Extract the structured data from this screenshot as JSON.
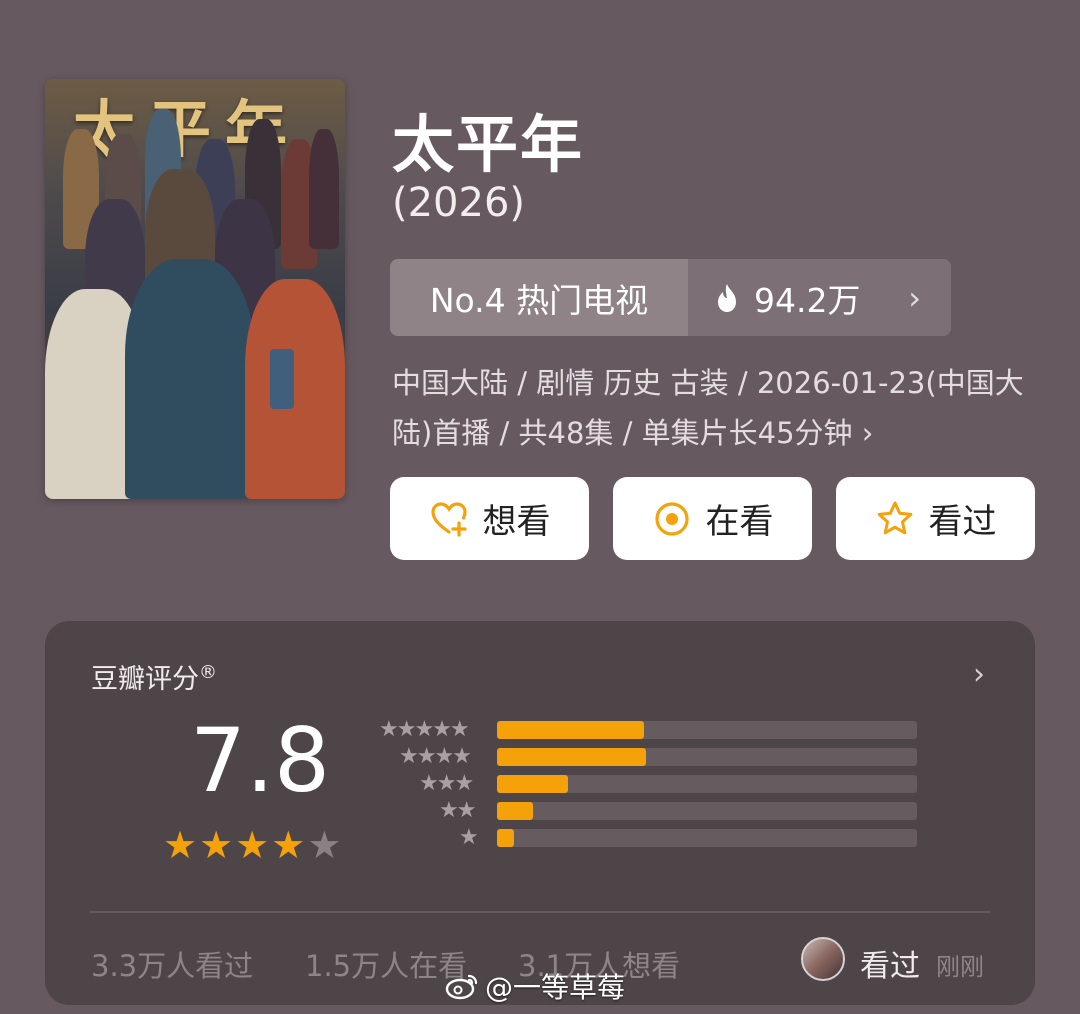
{
  "poster": {
    "title_art": "太平年"
  },
  "show": {
    "title": "太平年",
    "year": "(2026)"
  },
  "rank": {
    "label": "No.4 热门电视",
    "heat": "94.2万",
    "fire_icon": "fire-icon",
    "chevron": "›"
  },
  "meta": {
    "text": "中国大陆 / 剧情 历史 古装 / 2026-01-23(中国大陆)首播 / 共48集 / 单集片长45分钟 ›"
  },
  "actions": [
    {
      "label": "想看",
      "icon": "heart-plus-icon"
    },
    {
      "label": "在看",
      "icon": "target-icon"
    },
    {
      "label": "看过",
      "icon": "star-outline-icon"
    }
  ],
  "rating": {
    "label": "豆瓣评分",
    "registered": "®",
    "chevron": "›",
    "score": "7.8",
    "stars_filled": 4,
    "stars_total": 5,
    "distribution": [
      {
        "stars": "★★★★★",
        "fraction": 0.35
      },
      {
        "stars": "★★★★",
        "fraction": 0.355
      },
      {
        "stars": "★★★",
        "fraction": 0.17
      },
      {
        "stars": "★★",
        "fraction": 0.085
      },
      {
        "stars": "★",
        "fraction": 0.04
      }
    ],
    "stats": {
      "watched": "3.3万人看过",
      "watching": "1.5万人在看",
      "want": "3.1万人想看"
    },
    "friend": {
      "action": "看过",
      "time": "刚刚"
    }
  },
  "watermark": {
    "text": "@一等草莓"
  },
  "colors": {
    "accent": "#f5a10a",
    "background": "#66595f",
    "card": "#4e4548"
  }
}
